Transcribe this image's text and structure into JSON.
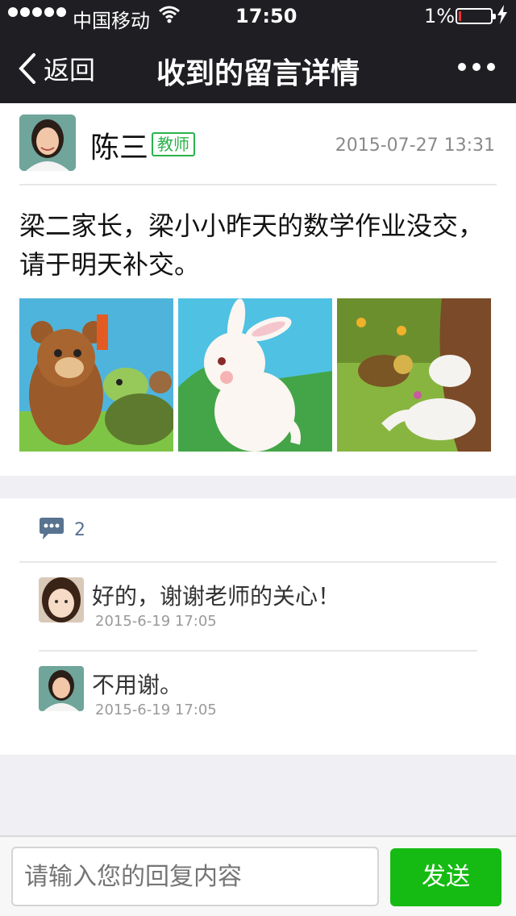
{
  "status_bar": {
    "carrier": "中国移动",
    "time": "17:50",
    "battery_percent": "1%",
    "battery_level": 0.01
  },
  "nav": {
    "back_label": "返回",
    "title": "收到的留言详情",
    "more_icon": "more-dots-icon"
  },
  "message": {
    "sender_name": "陈三",
    "sender_role": "教师",
    "timestamp": "2015-07-27 13:31",
    "body": "梁二家长，梁小小昨天的数学作业没交，请于明天补交。",
    "attachments": [
      "bear-and-turtle-image",
      "rabbit-image",
      "sleeping-rabbit-image"
    ]
  },
  "comments": {
    "icon": "comment-bubble-icon",
    "count": "2",
    "items": [
      {
        "text": "好的，谢谢老师的关心！",
        "time": "2015-6-19 17:05"
      },
      {
        "text": "不用谢。",
        "time": "2015-6-19 17:05"
      }
    ]
  },
  "reply": {
    "placeholder": "请输入您的回复内容",
    "send_label": "发送"
  },
  "colors": {
    "nav_background": "#1f1f23",
    "accent_green": "#15bb12",
    "badge_green": "#2bb34a",
    "comment_blue": "#58738f"
  }
}
